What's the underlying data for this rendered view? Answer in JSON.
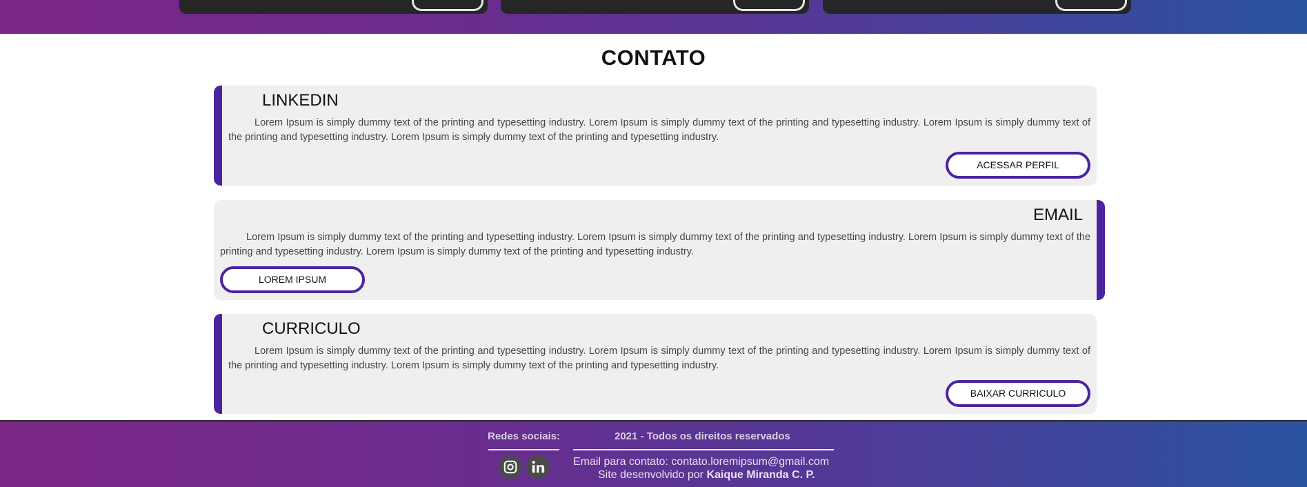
{
  "section": {
    "title": "CONTATO"
  },
  "cards": [
    {
      "title": "LINKEDIN",
      "text": "Lorem Ipsum is simply dummy text of the printing and typesetting industry. Lorem Ipsum is simply dummy text of the printing and typesetting industry. Lorem Ipsum is simply dummy text of the printing and typesetting industry. Lorem Ipsum is simply dummy text of the printing and typesetting industry.",
      "button": "ACESSAR PERFIL"
    },
    {
      "title": "EMAIL",
      "text": "Lorem Ipsum is simply dummy text of the printing and typesetting industry. Lorem Ipsum is simply dummy text of the printing and typesetting industry. Lorem Ipsum is simply dummy text of the printing and typesetting industry. Lorem Ipsum is simply dummy text of the printing and typesetting industry.",
      "button": "LOREM IPSUM"
    },
    {
      "title": "CURRICULO",
      "text": "Lorem Ipsum is simply dummy text of the printing and typesetting industry. Lorem Ipsum is simply dummy text of the printing and typesetting industry. Lorem Ipsum is simply dummy text of the printing and typesetting industry. Lorem Ipsum is simply dummy text of the printing and typesetting industry.",
      "button": "BAIXAR CURRICULO"
    }
  ],
  "footer": {
    "social_label": "Redes sociais:",
    "copyright": "2021 - Todos os direitos reservados",
    "email_line": "Email para contato: contato.loremipsum@gmail.com",
    "dev_prefix": "Site desenvolvido por",
    "dev_name": "Kaique Miranda C. P.",
    "icons": [
      "instagram-icon",
      "linkedin-icon"
    ]
  },
  "colors": {
    "accent": "#4b24a0",
    "gradient_start": "#7b2686",
    "gradient_end": "#2a53a1"
  }
}
